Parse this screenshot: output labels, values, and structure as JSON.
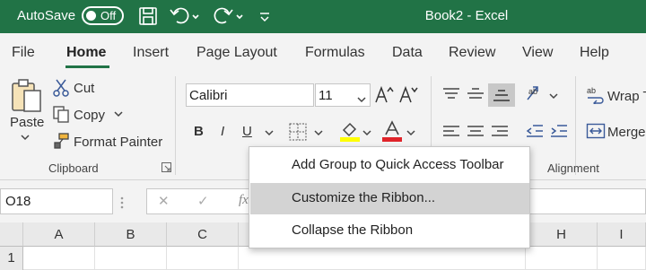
{
  "titlebar": {
    "autosave_label": "AutoSave",
    "autosave_state": "Off",
    "title": "Book2  -  Excel",
    "icons": [
      "save-icon",
      "undo-icon",
      "redo-icon",
      "customize-qat-icon"
    ]
  },
  "tabs": [
    {
      "label": "File"
    },
    {
      "label": "Home",
      "active": true
    },
    {
      "label": "Insert"
    },
    {
      "label": "Page Layout"
    },
    {
      "label": "Formulas"
    },
    {
      "label": "Data"
    },
    {
      "label": "Review"
    },
    {
      "label": "View"
    },
    {
      "label": "Help"
    }
  ],
  "ribbon": {
    "clipboard": {
      "paste": "Paste",
      "cut": "Cut",
      "copy": "Copy",
      "format_painter": "Format Painter",
      "group_label": "Clipboard"
    },
    "font": {
      "name": "Calibri",
      "size": "11",
      "bold": "B",
      "italic": "I",
      "underline": "U",
      "fill_color": "#ffff00",
      "font_color": "#e0242a"
    },
    "alignment": {
      "wrap_text": "Wrap T",
      "merge": "Merge",
      "group_label": "Alignment"
    }
  },
  "formula_bar": {
    "name_box": "O18",
    "cancel": "✕",
    "enter": "✓",
    "fx": "fx"
  },
  "grid": {
    "columns": [
      "A",
      "B",
      "C",
      "H",
      "I"
    ],
    "rows": [
      "1"
    ]
  },
  "context_menu": {
    "items": [
      {
        "label": "Add Group to Quick Access Toolbar"
      },
      {
        "label": "Customize the Ribbon...",
        "hover": true
      },
      {
        "label": "Collapse the Ribbon"
      }
    ]
  },
  "colors": {
    "accent": "#217346",
    "menu_hover": "#d3d3d3"
  }
}
